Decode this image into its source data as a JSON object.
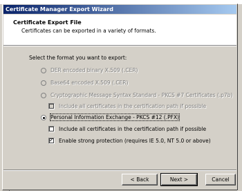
{
  "window": {
    "title": "Certificate Manager Export Wizard"
  },
  "header": {
    "title": "Certificate Export File",
    "subtitle": "Certificates can be exported in a variety of formats."
  },
  "prompt": "Select the format you want to export:",
  "options": [
    {
      "label": "DER encoded binary X.509 (.CER)",
      "enabled": false,
      "selected": false
    },
    {
      "label": "Base64 encoded X.509 (.CER)",
      "enabled": false,
      "selected": false
    },
    {
      "label": "Cryptographic Message Syntax Standard - PKCS #7 Certificates (.p7b)",
      "enabled": false,
      "selected": false
    },
    {
      "label": "Personal Information Exchange - PKCS #12 (.PFX)",
      "enabled": true,
      "selected": true
    }
  ],
  "p7b_checkbox": {
    "label": "Include all certificates in the certification path if possible",
    "enabled": false,
    "checked": false
  },
  "pfx_checkboxes": [
    {
      "label": "Include all certificates in the certification path if possible",
      "enabled": true,
      "checked": false
    },
    {
      "label": "Enable strong protection (requires IE 5.0, NT 5.0 or above)",
      "enabled": true,
      "checked": true
    }
  ],
  "buttons": {
    "back": "< Back",
    "next": "Next >",
    "cancel": "Cancel"
  }
}
